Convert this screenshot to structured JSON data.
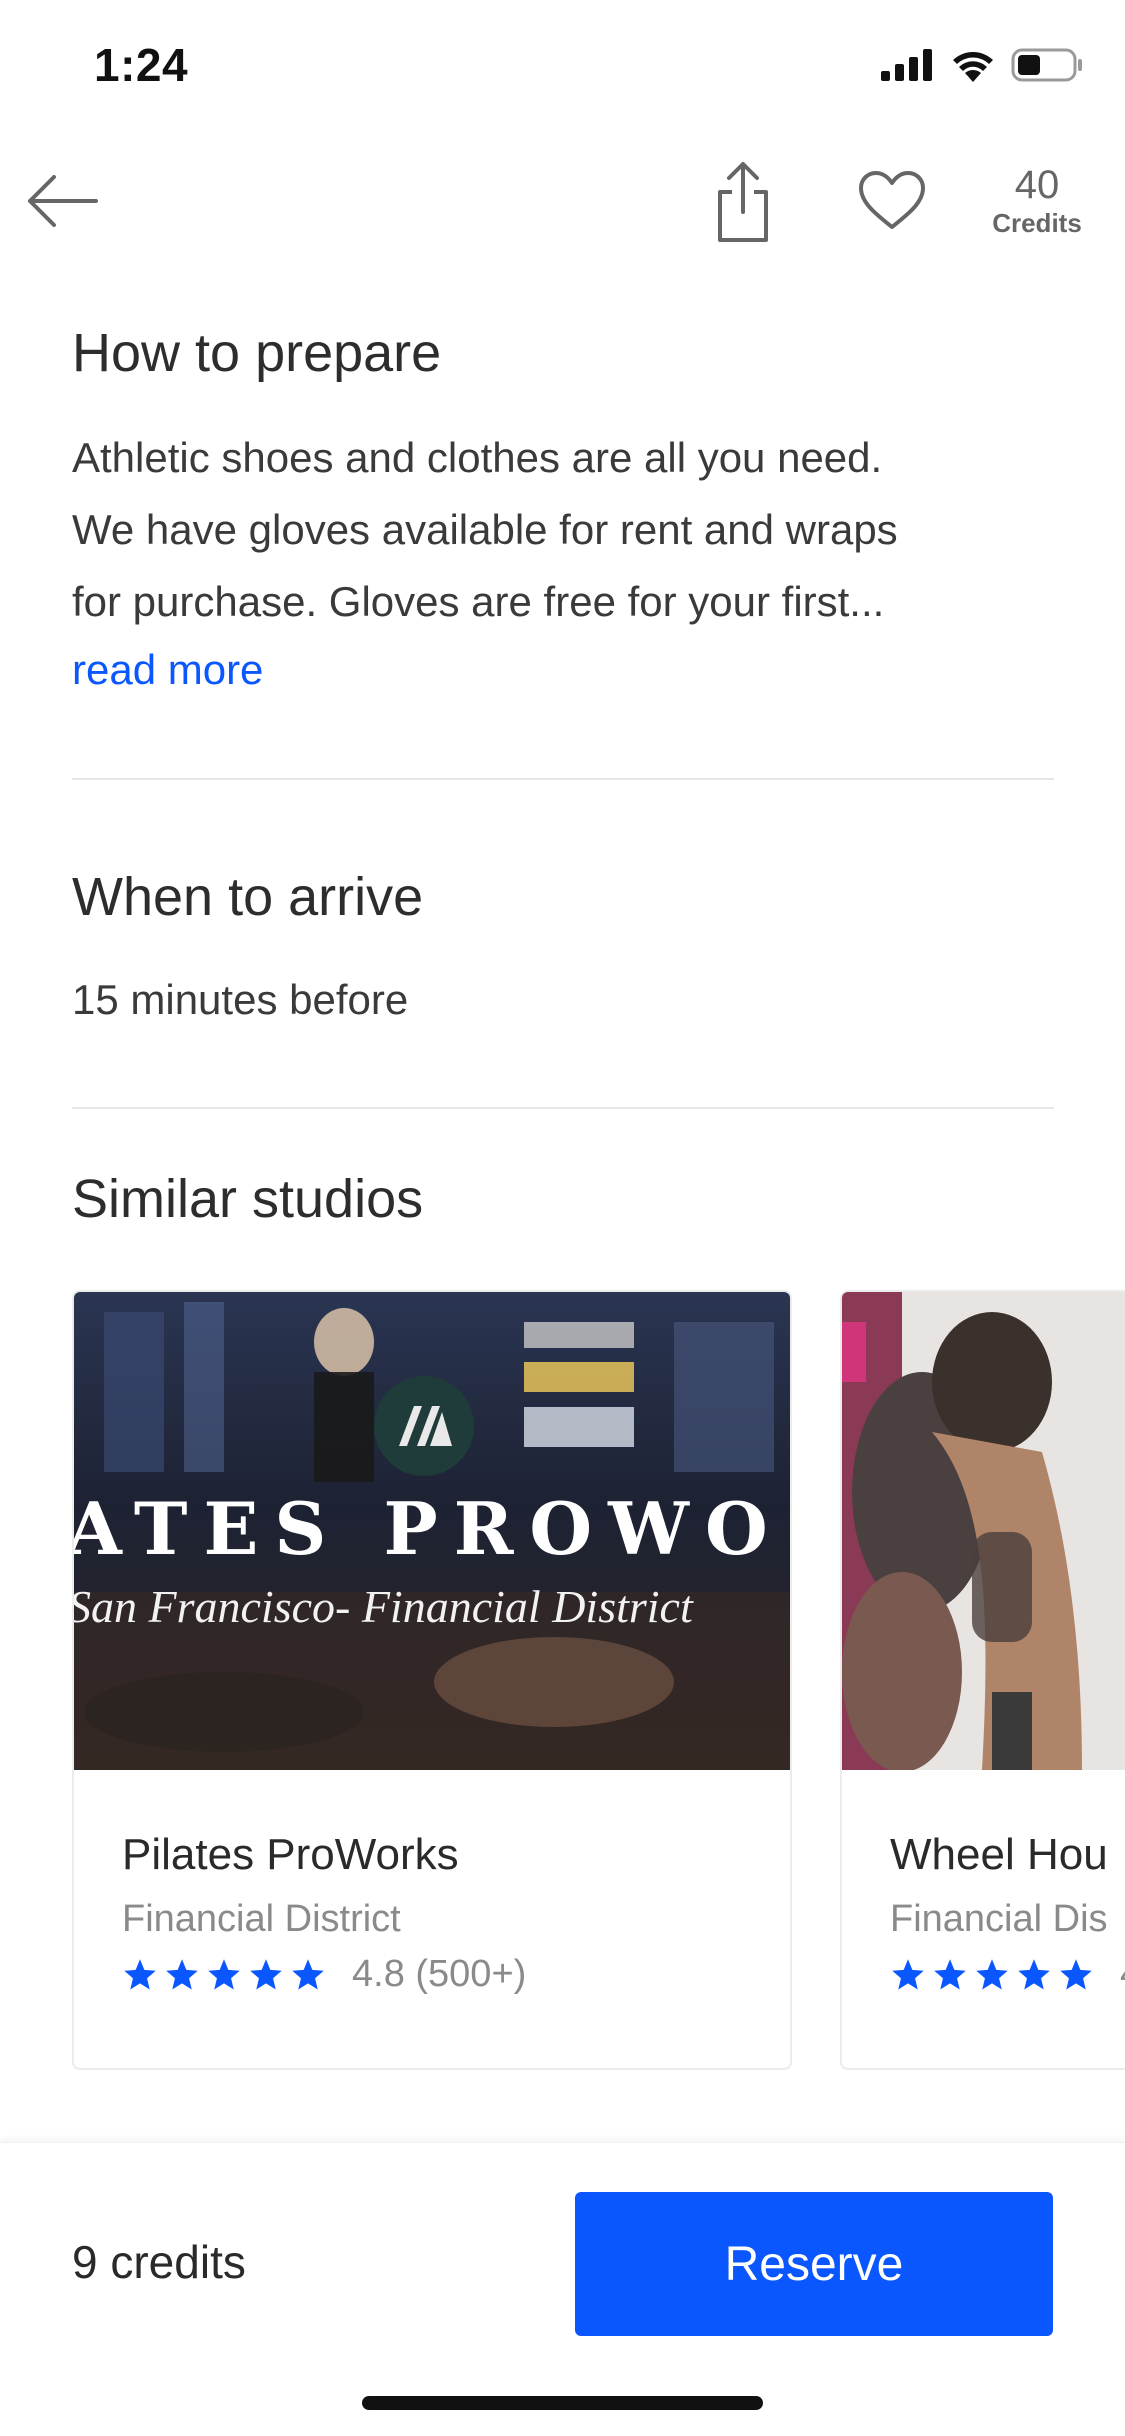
{
  "status_bar": {
    "time": "1:24"
  },
  "nav": {
    "credits_value": "40",
    "credits_label": "Credits"
  },
  "prepare": {
    "title": "How to prepare",
    "lines": [
      "Athletic shoes and clothes are all you need.",
      "We have gloves available for rent and wraps",
      "for purchase. Gloves are free for your first..."
    ],
    "read_more": "read more"
  },
  "arrive": {
    "title": "When to arrive",
    "text": "15 minutes before"
  },
  "similar": {
    "title": "Similar studios",
    "studios": [
      {
        "name": "Pilates ProWorks",
        "area": "Financial District",
        "rating": "4.8 (500+)",
        "stars": 5,
        "image_banner": "ATES PROWO",
        "image_subtitle": "San Francisco- Financial District"
      },
      {
        "name": "Wheel Hou",
        "area": "Financial Dis",
        "rating": "4",
        "stars": 5
      }
    ]
  },
  "footer": {
    "credits": "9 credits",
    "reserve_label": "Reserve"
  },
  "colors": {
    "accent": "#0a57ff",
    "text": "#2d2d2d",
    "muted": "#8a8a8a"
  }
}
